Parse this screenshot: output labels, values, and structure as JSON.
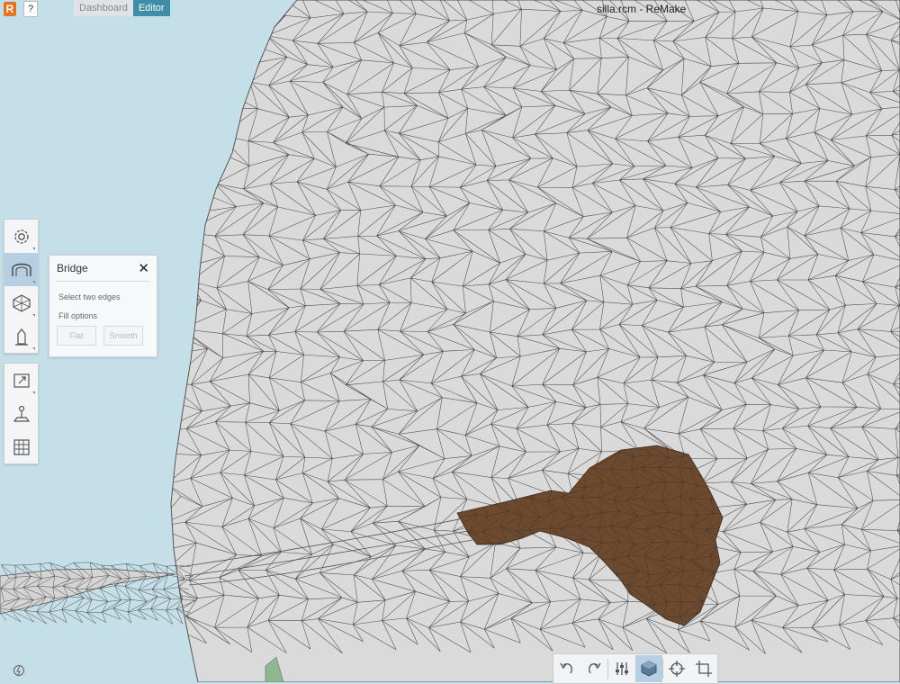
{
  "app": {
    "logo_letter": "R",
    "help_label": "?",
    "title": "silla.rcm - ReMake"
  },
  "tabs": [
    {
      "label": "Dashboard",
      "active": false
    },
    {
      "label": "Editor",
      "active": true
    }
  ],
  "toolbar_top": [
    {
      "icon": "settings-icon"
    },
    {
      "icon": "bridge-icon",
      "active": true
    },
    {
      "icon": "mesh-shape-icon"
    },
    {
      "icon": "sculpt-icon"
    }
  ],
  "toolbar_bottom": [
    {
      "icon": "export-icon"
    },
    {
      "icon": "joystick-icon"
    },
    {
      "icon": "grid-icon"
    }
  ],
  "bridge_panel": {
    "title": "Bridge",
    "close_label": "✕",
    "instruction": "Select two edges",
    "fill_options_label": "Fill options",
    "buttons": [
      "Flat",
      "Smooth"
    ]
  },
  "bottom_bar": {
    "buttons": [
      {
        "icon": "undo-icon"
      },
      {
        "icon": "redo-icon"
      },
      {
        "icon": "sliders-icon"
      },
      {
        "icon": "shaded-view-icon",
        "active": true
      },
      {
        "icon": "target-icon"
      },
      {
        "icon": "crop-icon"
      }
    ]
  },
  "colors": {
    "background": "#c5dfe9",
    "mesh_surface": "#dadada",
    "mesh_lines": "#4a4a4a",
    "hole_fill": "#6b4a30",
    "accent": "#3d8ea6"
  }
}
